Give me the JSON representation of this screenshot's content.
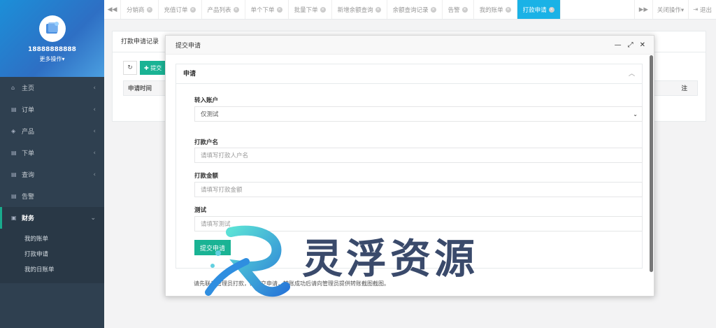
{
  "sidebar": {
    "phone": "18888888888",
    "more_ops": "更多操作▾",
    "nav": [
      {
        "label": "主页",
        "icon": "home-icon"
      },
      {
        "label": "订单",
        "icon": "file-icon"
      },
      {
        "label": "产品",
        "icon": "cube-icon"
      },
      {
        "label": "下单",
        "icon": "file-icon"
      },
      {
        "label": "查询",
        "icon": "file-icon"
      },
      {
        "label": "告警",
        "icon": "file-icon"
      },
      {
        "label": "财务",
        "icon": "money-icon"
      }
    ],
    "finance_sub": [
      "我的账单",
      "打款申请",
      "我的日账单"
    ]
  },
  "tabs": [
    "分销商",
    "充值订单",
    "产品列表",
    "单个下单",
    "批量下单",
    "新增余额查询",
    "余额查询记录",
    "告警",
    "我的账单",
    "打款申请"
  ],
  "active_tab": "打款申请",
  "topbar": {
    "close_ops": "关闭操作▾",
    "logout": "退出"
  },
  "page": {
    "panel_title": "打款申请记录",
    "add_button": "提交",
    "col_first": "申请时间",
    "col_last": "注"
  },
  "modal": {
    "title": "提交申请",
    "card_title": "申请",
    "fields": {
      "account": {
        "label": "转入账户",
        "value": "仅测试"
      },
      "payer": {
        "label": "打款户名",
        "placeholder": "请填写打款人户名"
      },
      "amount": {
        "label": "打款金额",
        "placeholder": "请填写打款金额"
      },
      "test": {
        "label": "测试",
        "placeholder": "请填写测试"
      }
    },
    "submit": "提交申请",
    "notice": "请先联系管理员打款，再提交申请，转账成功后请向管理员提供转账截图截图。"
  },
  "watermark": {
    "text": "灵浮资源"
  },
  "colors": {
    "sidebar": "#2f4050",
    "accent": "#1ab394",
    "active_tab": "#1ab2e6"
  }
}
